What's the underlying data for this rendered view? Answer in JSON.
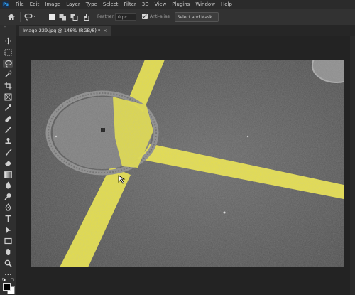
{
  "app": {
    "logo_text": "Ps"
  },
  "menubar": {
    "items": [
      "File",
      "Edit",
      "Image",
      "Layer",
      "Type",
      "Select",
      "Filter",
      "3D",
      "View",
      "Plugins",
      "Window",
      "Help"
    ]
  },
  "options": {
    "feather_label": "Feather:",
    "feather_value": "0 px",
    "antialias_label": "Anti-alias",
    "antialias_checked": true,
    "select_mask_label": "Select and Mask..."
  },
  "document": {
    "tab_title": "Image-229.jpg @ 146% (RGB/8) *",
    "close_glyph": "×"
  },
  "tools": [
    "move-tool",
    "marquee-tool",
    "lasso-tool",
    "quick-select-tool",
    "crop-tool",
    "frame-tool",
    "eyedropper-tool",
    "healing-brush-tool",
    "brush-tool",
    "clone-stamp-tool",
    "history-brush-tool",
    "eraser-tool",
    "gradient-tool",
    "blur-tool",
    "dodge-tool",
    "pen-tool",
    "type-tool",
    "path-select-tool",
    "rectangle-tool",
    "hand-tool",
    "zoom-tool",
    "more-tools"
  ],
  "colors": {
    "accent": "#31a8ff",
    "asphalt": "#5a5a5a",
    "line_yellow": "#e6e04a",
    "foreground": "#000000",
    "background": "#ffffff"
  }
}
